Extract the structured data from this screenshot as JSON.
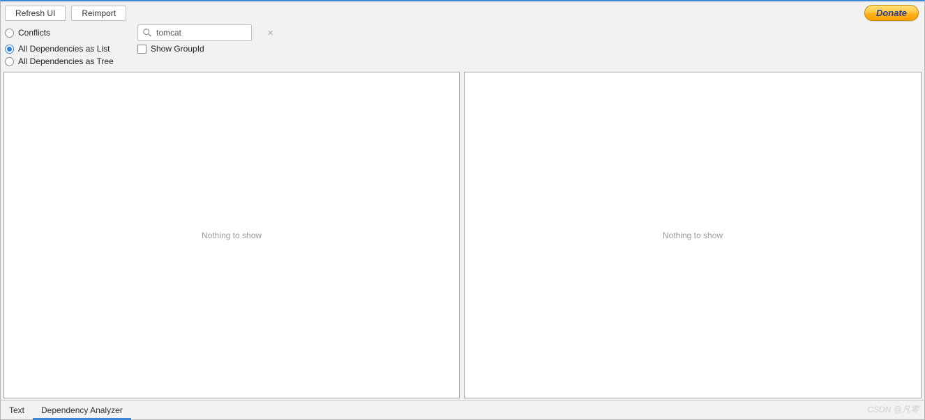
{
  "toolbar": {
    "refresh_label": "Refresh UI",
    "reimport_label": "Reimport",
    "donate_label": "Donate"
  },
  "filters": {
    "conflicts_label": "Conflicts",
    "deps_list_label": "All Dependencies as List",
    "deps_tree_label": "All Dependencies as Tree",
    "show_groupid_label": "Show GroupId",
    "selected": "deps_list"
  },
  "search": {
    "value": "tomcat"
  },
  "panels": {
    "left_empty": "Nothing to show",
    "right_empty": "Nothing to show"
  },
  "tabs": {
    "text_label": "Text",
    "analyzer_label": "Dependency Analyzer",
    "active": "analyzer"
  },
  "watermark": "CSDN @凡零"
}
